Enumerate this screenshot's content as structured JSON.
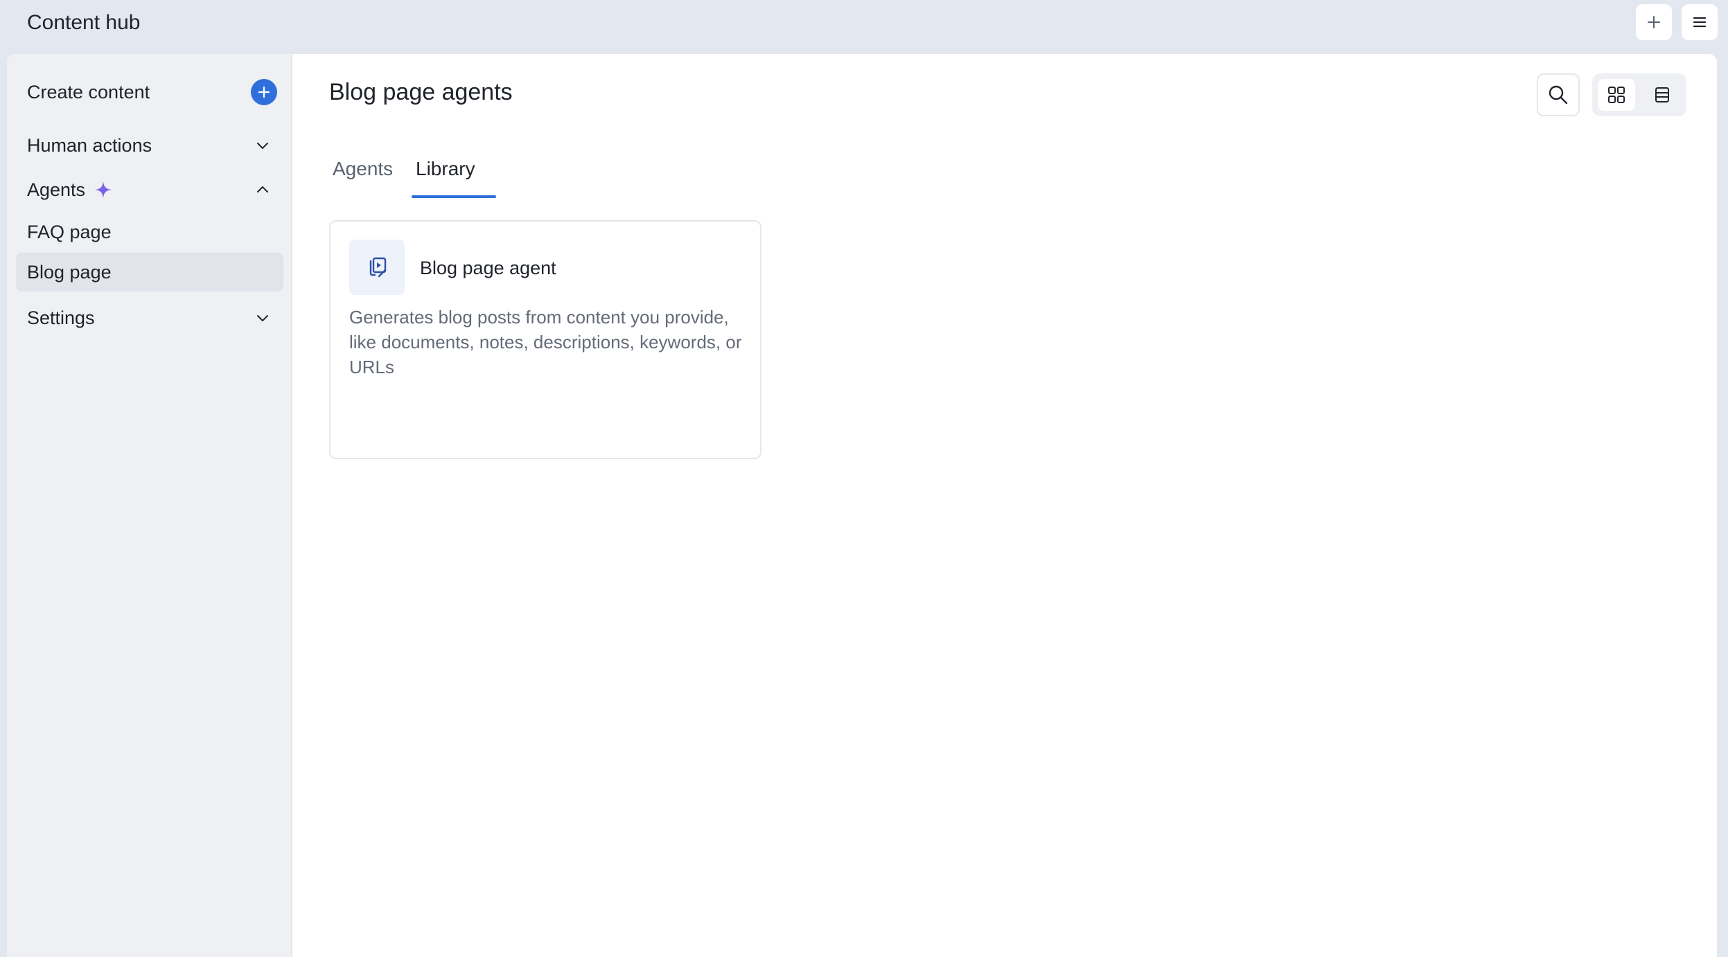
{
  "app": {
    "title": "Content hub"
  },
  "topbar": {
    "icons": [
      "plus-icon",
      "hamburger-menu-icon"
    ]
  },
  "sidebar": {
    "create_label": "Create content",
    "items": [
      {
        "label": "Human actions",
        "expanded": false
      },
      {
        "label": "Agents",
        "expanded": true
      },
      {
        "label": "Settings",
        "expanded": false
      }
    ],
    "agents_children": [
      {
        "label": "FAQ page",
        "active": false
      },
      {
        "label": "Blog page",
        "active": true
      }
    ]
  },
  "main": {
    "title": "Blog page agents",
    "tabs": [
      {
        "label": "Agents",
        "active": false
      },
      {
        "label": "Library",
        "active": true
      }
    ],
    "view_mode": "grid",
    "cards": [
      {
        "title": "Blog page agent",
        "description": "Generates blog posts from content you provide, like documents, notes, descriptions, keywords, or URLs",
        "icon": "blog-agent-icon"
      }
    ]
  },
  "colors": {
    "accent": "#2f6fdb",
    "sparkle": "#7b61e8",
    "sidebar_bg": "#eef0f4",
    "page_bg": "#e3e7ef"
  }
}
